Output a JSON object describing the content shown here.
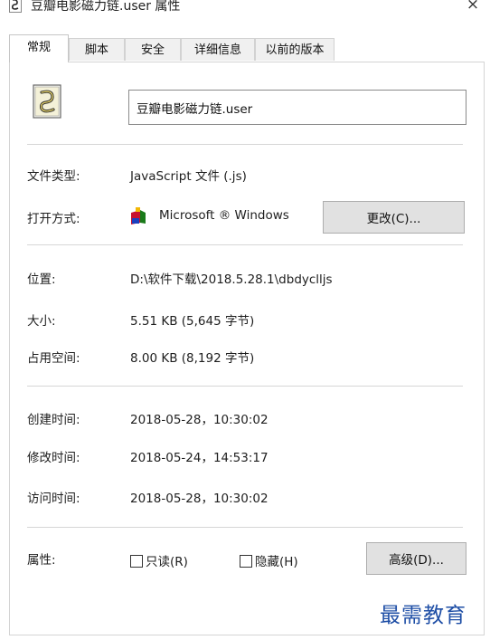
{
  "window": {
    "title": "豆瓣电影磁力链.user 属性",
    "close_label": "×"
  },
  "tabs": [
    {
      "label": "常规",
      "active": true
    },
    {
      "label": "脚本"
    },
    {
      "label": "安全"
    },
    {
      "label": "详细信息"
    },
    {
      "label": "以前的版本"
    }
  ],
  "general": {
    "icon": "js-script-file-icon",
    "file_name": "豆瓣电影磁力链.user",
    "rows": {
      "type": {
        "label": "文件类型:",
        "value": "JavaScript 文件 (.js)"
      },
      "opens_with": {
        "label": "打开方式:",
        "value": "Microsoft ® Windows",
        "icon": "windows-script-host-icon",
        "button": "更改(C)..."
      },
      "location": {
        "label": "位置:",
        "value": "D:\\软件下载\\2018.5.28.1\\dbdyclljs"
      },
      "size": {
        "label": "大小:",
        "value": "5.51 KB (5,645 字节)"
      },
      "size_on_disk": {
        "label": "占用空间:",
        "value": "8.00 KB (8,192 字节)"
      },
      "created": {
        "label": "创建时间:",
        "value": "2018-05-28，10:30:02"
      },
      "modified": {
        "label": "修改时间:",
        "value": "2018-05-24，14:53:17"
      },
      "accessed": {
        "label": "访问时间:",
        "value": "2018-05-28，10:30:02"
      }
    },
    "attributes": {
      "label": "属性:",
      "readonly": {
        "label": "只读(R)",
        "checked": false
      },
      "hidden": {
        "label": "隐藏(H)",
        "checked": false
      },
      "advanced_button": "高级(D)..."
    }
  },
  "watermark": "最需教育",
  "colors": {
    "watermark": "#1f4fa6",
    "button_bg": "#e1e1e1",
    "border": "#d4d4d4"
  }
}
